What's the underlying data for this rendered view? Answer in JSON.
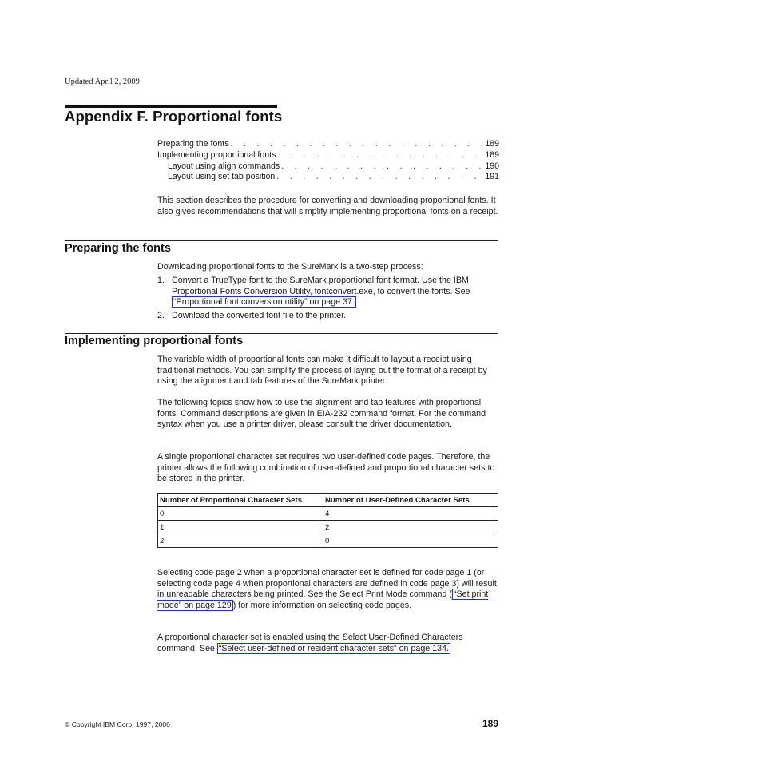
{
  "header": {
    "updated": "Updated April 2, 2009"
  },
  "title": "Appendix F. Proportional fonts",
  "toc": [
    {
      "label": "Preparing the fonts",
      "page": "189",
      "level": 1
    },
    {
      "label": "Implementing proportional fonts",
      "page": "189",
      "level": 1
    },
    {
      "label": "Layout using align commands",
      "page": "190",
      "level": 2
    },
    {
      "label": "Layout using set tab position",
      "page": "191",
      "level": 2
    }
  ],
  "toc_leader": ". . . . . . . . . . . . . . . . . . . . . . . . . . . . . . . . . . . . . . . .",
  "intro": "This section describes the procedure for converting and downloading proportional fonts. It also gives recommendations that will simplify implementing proportional fonts on a receipt.",
  "sections": {
    "preparing": {
      "heading": "Preparing the fonts",
      "lead": "Downloading proportional fonts to the SureMark is a two-step process:",
      "steps": [
        {
          "num": "1.",
          "text": "Convert a TrueType font to the SureMark proportional font format. Use the IBM Proportional Fonts Conversion Utility, fontconvert.exe, to convert the fonts. See ",
          "link": "“Proportional font conversion utility” on page 37.",
          "tail": ""
        },
        {
          "num": "2.",
          "text": "Download the converted font file to the printer.",
          "link": "",
          "tail": ""
        }
      ]
    },
    "implementing": {
      "heading": "Implementing proportional fonts",
      "para1": "The variable width of proportional fonts can make it difficult to layout a receipt using traditional methods. You can simplify the process of laying out the format of a receipt by using the alignment and tab features of the SureMark printer.",
      "para2": "The following topics show how to use the alignment and tab features with proportional fonts. Command descriptions are given in EIA-232 command format. For the command syntax when you use a printer driver, please consult the driver documentation.",
      "para3": "A single proportional character set requires two user-defined code pages. Therefore, the printer allows the following combination of user-defined and proportional character sets to be stored in the printer.",
      "table": {
        "headers": [
          "Number of Proportional Character Sets",
          "Number of User-Defined Character Sets"
        ],
        "rows": [
          [
            "0",
            "4"
          ],
          [
            "1",
            "2"
          ],
          [
            "2",
            "0"
          ]
        ]
      },
      "para4_pre": "Selecting code page 2 when a proportional character set is defined for code page 1 (or selecting code page 4 when proportional characters are defined in code page 3) will result in unreadable characters being printed. See the Select Print Mode command (",
      "para4_link": "“Set print mode” on page 129",
      "para4_post": ") for more information on selecting code pages.",
      "para5_pre": "A proportional character set is enabled using the Select User-Defined Characters command. See ",
      "para5_link": "“Select user-defined or resident character sets” on page 134.",
      "para5_post": ""
    }
  },
  "footer": {
    "copyright": "© Copyright IBM Corp. 1997, 2006",
    "page_number": "189"
  },
  "colors": {
    "link_border": "#1a2fe0",
    "text": "#1a1a1a"
  }
}
